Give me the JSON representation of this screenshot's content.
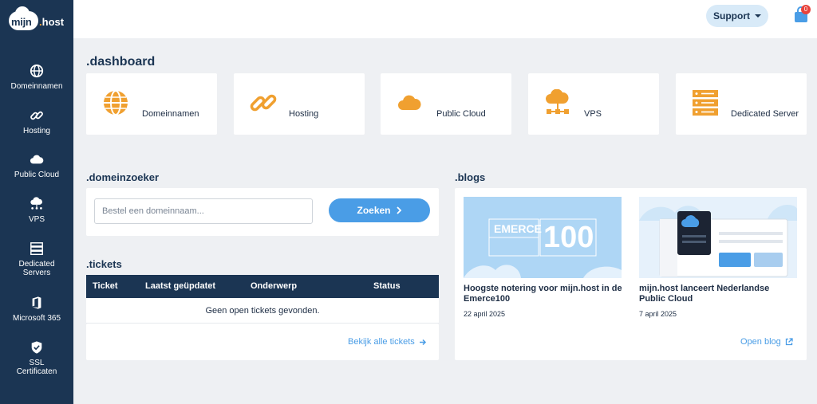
{
  "brand": {
    "logo_mijn": "mijn",
    "logo_dot": ".",
    "logo_host": "host"
  },
  "sidebar": {
    "items": [
      {
        "label": "Domeinnamen",
        "icon": "globe-icon"
      },
      {
        "label": "Hosting",
        "icon": "link-icon"
      },
      {
        "label": "Public Cloud",
        "icon": "cloud-icon"
      },
      {
        "label": "VPS",
        "icon": "cloud-network-icon"
      },
      {
        "label": "Dedicated Servers",
        "icon": "server-icon"
      },
      {
        "label": "Microsoft 365",
        "icon": "office-icon"
      },
      {
        "label": "SSL Certificaten",
        "icon": "shield-check-icon"
      }
    ]
  },
  "topbar": {
    "support_label": "Support",
    "cart_count": "0"
  },
  "dashboard": {
    "title": ".dashboard",
    "cards": [
      {
        "label": "Domeinnamen",
        "icon": "globe-icon"
      },
      {
        "label": "Hosting",
        "icon": "link-icon"
      },
      {
        "label": "Public Cloud",
        "icon": "cloud-icon"
      },
      {
        "label": "VPS",
        "icon": "cloud-network-icon"
      },
      {
        "label": "Dedicated Server",
        "icon": "server-icon"
      }
    ]
  },
  "domeinzoeker": {
    "title": ".domeinzoeker",
    "placeholder": "Bestel een domeinnaam...",
    "button_label": "Zoeken"
  },
  "tickets": {
    "title": ".tickets",
    "columns": [
      "Ticket",
      "Laatst geüpdatet",
      "Onderwerp",
      "Status"
    ],
    "empty_text": "Geen open tickets gevonden.",
    "view_all_label": "Bekijk alle tickets"
  },
  "blogs": {
    "title": ".blogs",
    "posts": [
      {
        "title": "Hoogste notering voor mijn.host in de Emerce100",
        "date": "22 april 2025",
        "image_text_emerce": "EMERCE",
        "image_text_100": "100"
      },
      {
        "title": "mijn.host lanceert Nederlandse Public Cloud",
        "date": "7 april 2025"
      }
    ],
    "open_label": "Open blog"
  },
  "colors": {
    "sidebar": "#1b3553",
    "accent": "#4a9de6",
    "icon_orange": "#f0a030",
    "badge": "#e8433c"
  }
}
